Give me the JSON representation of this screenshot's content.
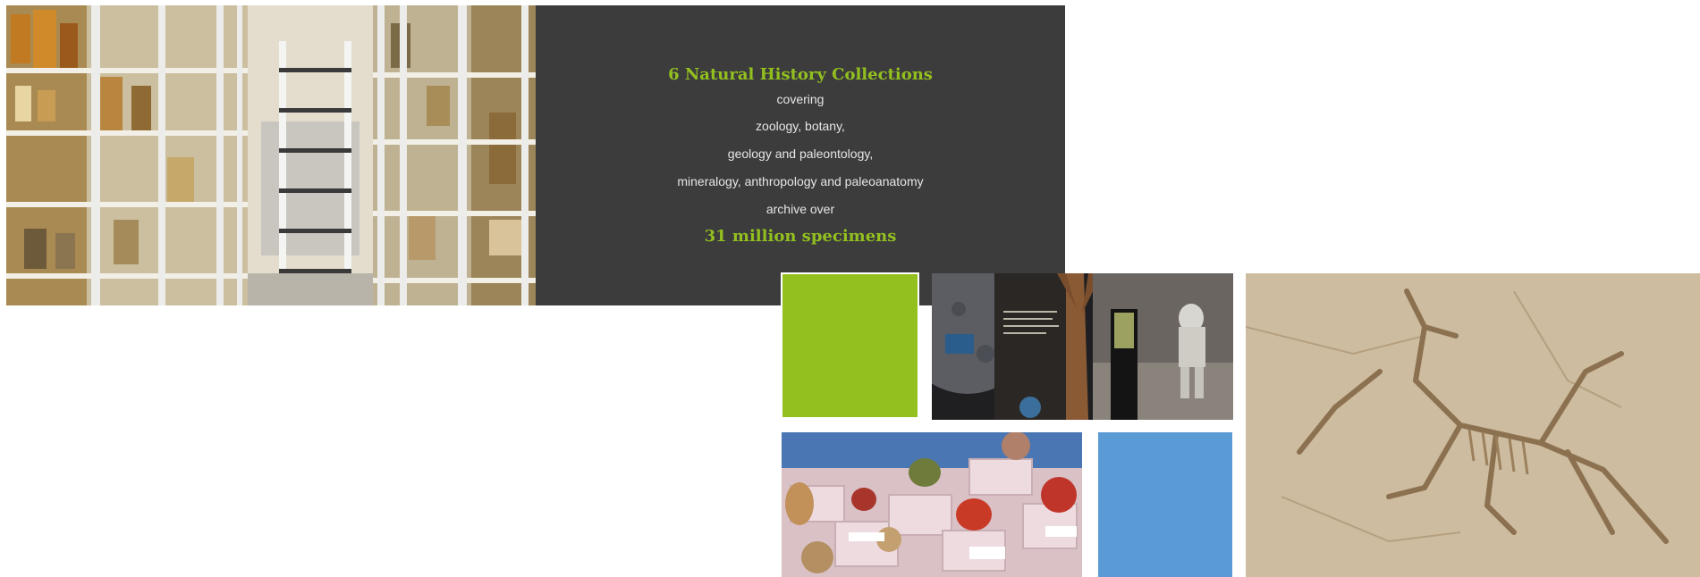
{
  "colors": {
    "accent_green": "#93c01f",
    "accent_blue": "#5b9bd5",
    "panel_background": "#3c3c3c",
    "panel_text": "#e6e6e6"
  },
  "info_panel": {
    "heading": "6 Natural History Collections",
    "lines": [
      "covering",
      "zoology, botany,",
      "geology and paleontology,",
      "mineralogy, anthropology and paleoanatomy",
      "archive over"
    ],
    "highlight": "31 million specimens"
  }
}
